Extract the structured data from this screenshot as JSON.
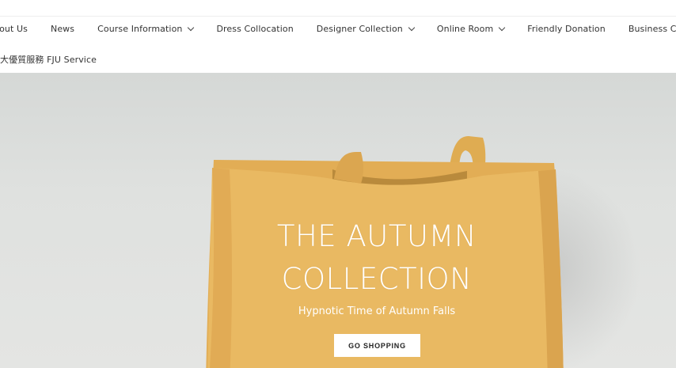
{
  "nav": {
    "items": [
      {
        "label": "bout Us",
        "has_dropdown": false
      },
      {
        "label": "News",
        "has_dropdown": false
      },
      {
        "label": "Course Information",
        "has_dropdown": true
      },
      {
        "label": "Dress Collocation",
        "has_dropdown": false
      },
      {
        "label": "Designer Collection",
        "has_dropdown": true
      },
      {
        "label": "Online Room",
        "has_dropdown": true
      },
      {
        "label": "Friendly Donation",
        "has_dropdown": false
      },
      {
        "label": "Business Cooperation",
        "has_dropdown": true
      }
    ],
    "row2_label": "大優質服務 FJU Service"
  },
  "hero": {
    "title_line1": "THE AUTUMN",
    "title_line2": "COLLECTION",
    "subtitle": "Hypnotic Time of Autumn Falls",
    "button_label": "GO SHOPPING",
    "image_subject": "tote-bag-photo"
  },
  "colors": {
    "bag": "#e8b85f",
    "bag_shade": "#d9a54c",
    "background": "#dcdedc",
    "text_dark": "#333333",
    "white": "#ffffff"
  }
}
